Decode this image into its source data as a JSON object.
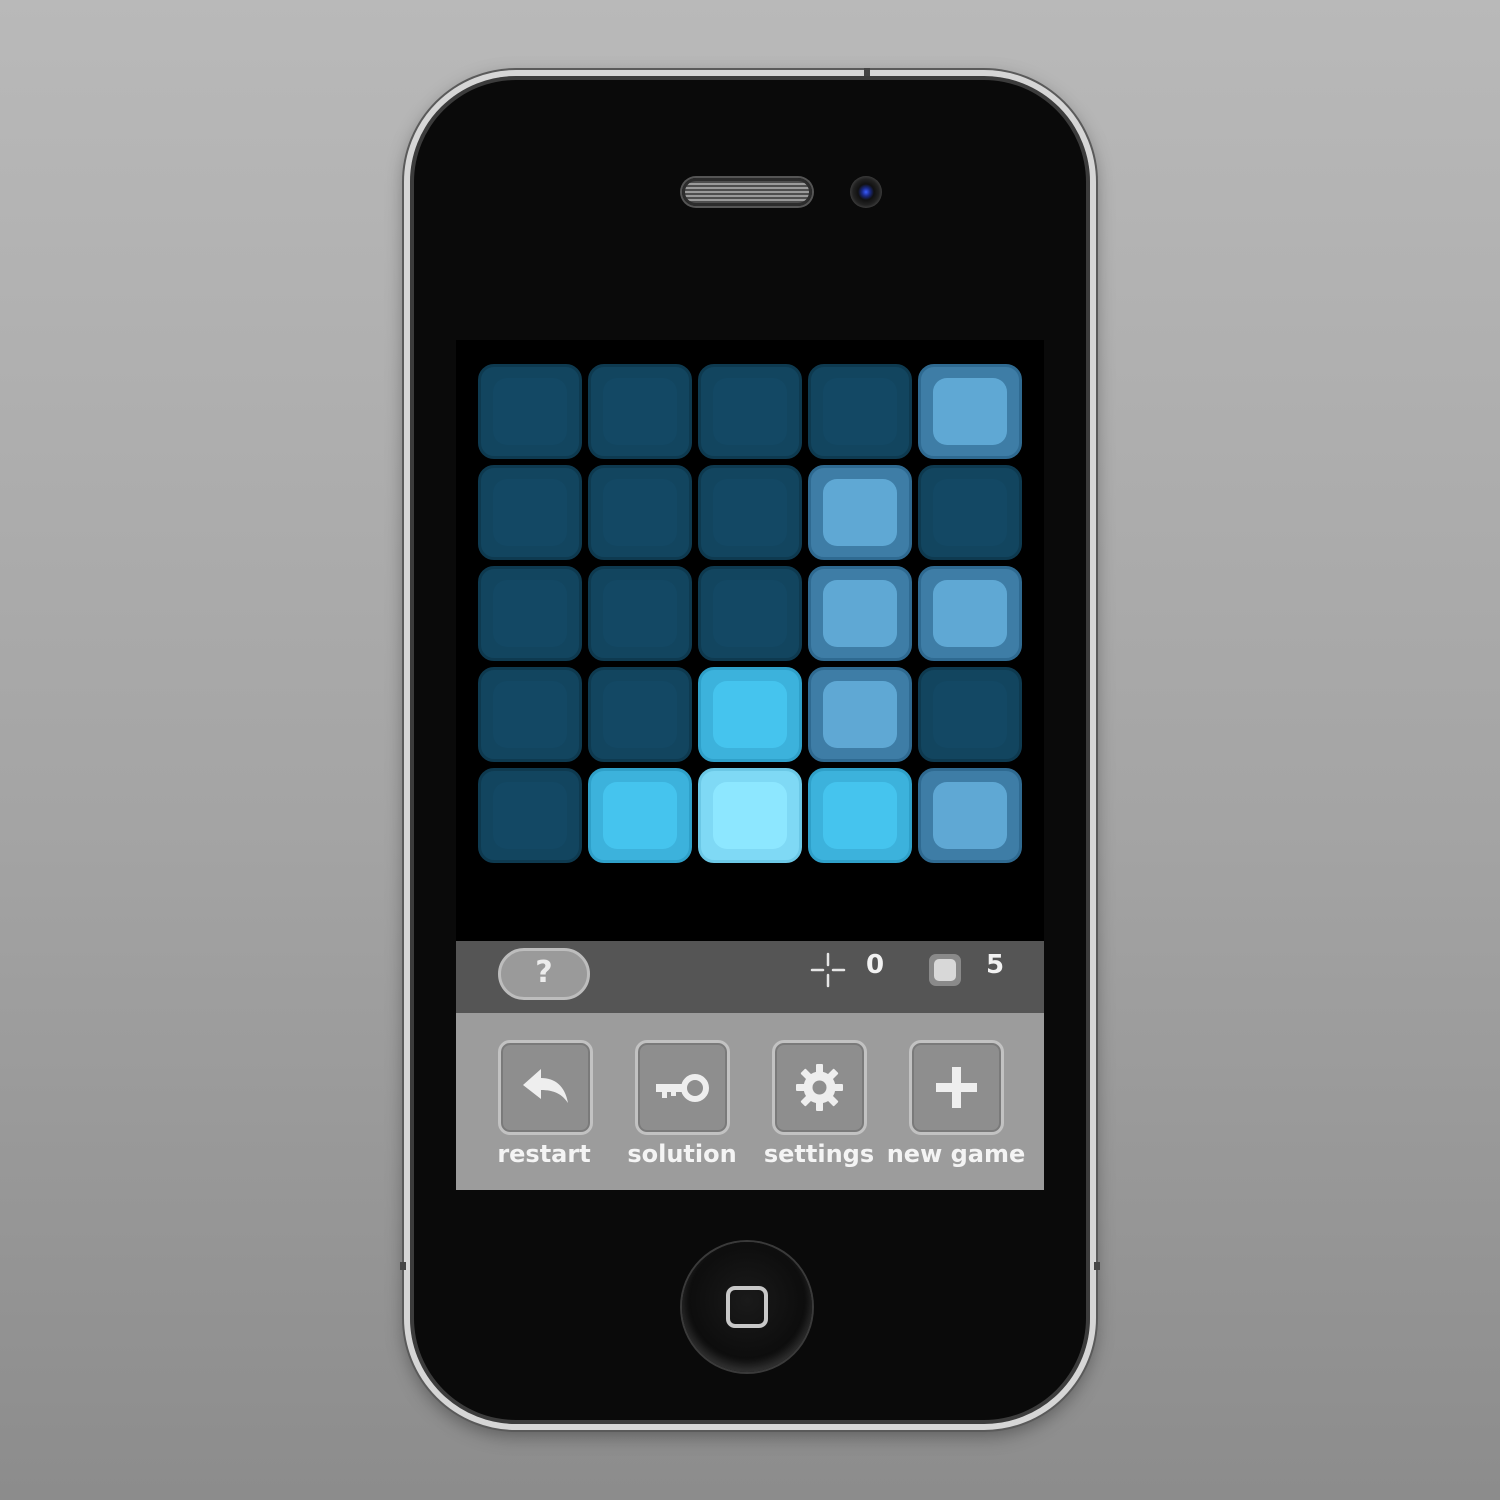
{
  "game": {
    "grid": [
      [
        0,
        0,
        0,
        0,
        1
      ],
      [
        0,
        0,
        0,
        1,
        0
      ],
      [
        0,
        0,
        0,
        1,
        1
      ],
      [
        0,
        0,
        2,
        1,
        0
      ],
      [
        0,
        2,
        3,
        2,
        1
      ]
    ],
    "tile_colors": {
      "0": {
        "outer": "#12455f",
        "inner": "#134864",
        "edge": "#0e3a50"
      },
      "1": {
        "outer": "#3e7da6",
        "inner": "#5fa8d4",
        "edge": "#2f6a91"
      },
      "2": {
        "outer": "#3cb2dc",
        "inner": "#45c4ee",
        "edge": "#2fa0c9"
      },
      "3": {
        "outer": "#7fd9f5",
        "inner": "#8de7ff",
        "edge": "#6cc8e6"
      }
    }
  },
  "status": {
    "help_label": "?",
    "moves_icon": "crosshair-icon",
    "moves_value": "0",
    "tiles_icon": "tile-icon",
    "tiles_value": "5"
  },
  "toolbar": {
    "restart_label": "restart",
    "solution_label": "solution",
    "settings_label": "settings",
    "new_game_label": "new game",
    "restart_icon": "undo-arrow-icon",
    "solution_icon": "key-icon",
    "settings_icon": "gear-icon",
    "new_game_icon": "plus-icon"
  }
}
